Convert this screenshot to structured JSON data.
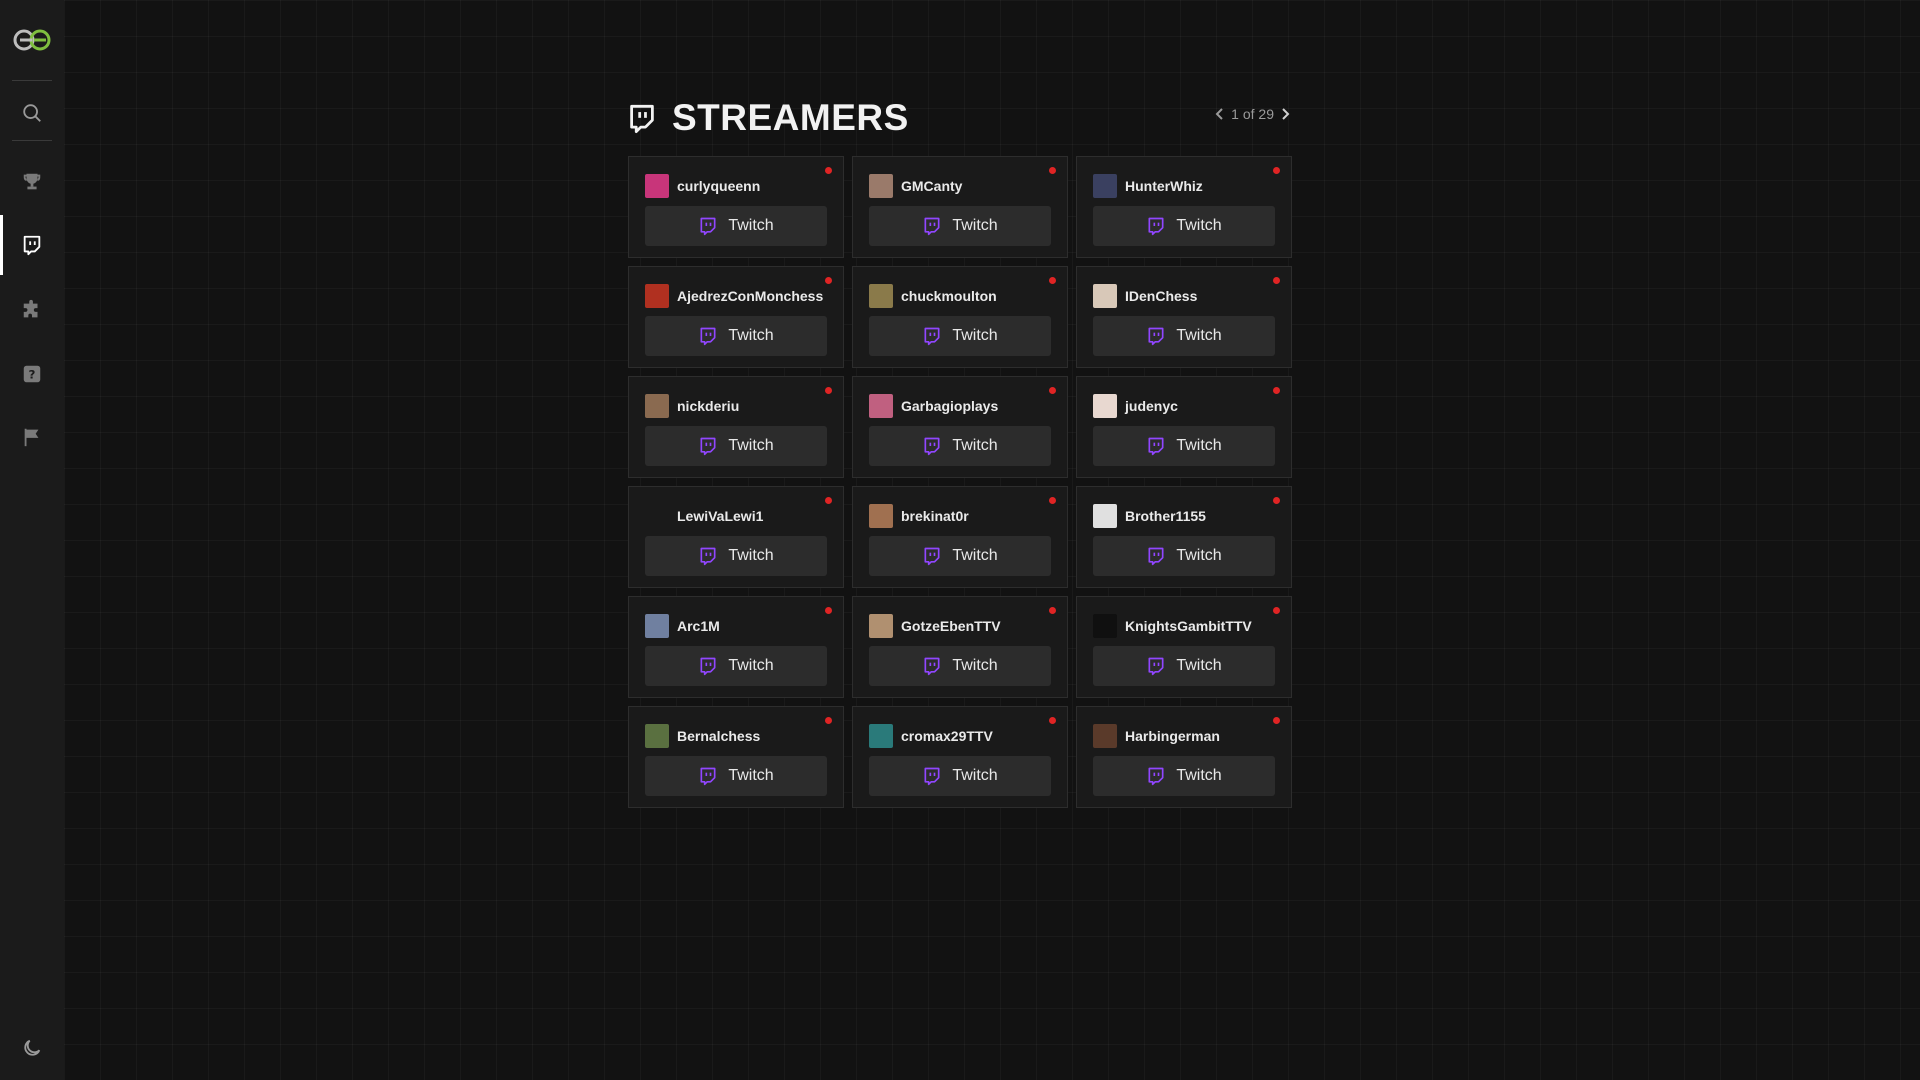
{
  "header": {
    "title": "STREAMERS",
    "pagination": "1 of 29"
  },
  "colors": {
    "background": "#121212",
    "card": "#1a1a1a",
    "button": "#2c2c2c",
    "twitch_purple": "#9146ff",
    "live": "#e02424",
    "logo_green": "#7fbf3f"
  },
  "sidebar": {
    "items": [
      {
        "icon": "search-icon"
      },
      {
        "icon": "trophy-icon"
      },
      {
        "icon": "twitch-icon",
        "active": true
      },
      {
        "icon": "puzzle-icon"
      },
      {
        "icon": "question-icon"
      },
      {
        "icon": "flag-icon"
      }
    ],
    "bottom_icon": "moon-icon"
  },
  "button_label": "Twitch",
  "streamers": [
    {
      "name": "curlyqueenn",
      "avatar": "#c8357a",
      "live": true
    },
    {
      "name": "GMCanty",
      "avatar": "#9a7a6a",
      "live": true
    },
    {
      "name": "HunterWhiz",
      "avatar": "#3a4060",
      "live": true
    },
    {
      "name": "AjedrezConMonchess",
      "avatar": "#b03020",
      "live": true
    },
    {
      "name": "chuckmoulton",
      "avatar": "#8a7a4a",
      "live": true
    },
    {
      "name": "IDenChess",
      "avatar": "#d8c8b8",
      "live": true
    },
    {
      "name": "nickderiu",
      "avatar": "#8a6a50",
      "live": true
    },
    {
      "name": "Garbagioplays",
      "avatar": "#c06080",
      "live": true
    },
    {
      "name": "judenyc",
      "avatar": "#e8d8d0",
      "live": true
    },
    {
      "name": "LewiVaLewi1",
      "avatar": "#1a1a1a",
      "live": true
    },
    {
      "name": "brekinat0r",
      "avatar": "#a07050",
      "live": true
    },
    {
      "name": "Brother1155",
      "avatar": "#e0e0e0",
      "live": true
    },
    {
      "name": "Arc1M",
      "avatar": "#7080a0",
      "live": true
    },
    {
      "name": "GotzeEbenTTV",
      "avatar": "#b09070",
      "live": true
    },
    {
      "name": "KnightsGambitTTV",
      "avatar": "#101010",
      "live": true
    },
    {
      "name": "Bernalchess",
      "avatar": "#5a7040",
      "live": true
    },
    {
      "name": "cromax29TTV",
      "avatar": "#2a7a7a",
      "live": true
    },
    {
      "name": "Harbingerman",
      "avatar": "#5a3a2a",
      "live": true
    }
  ]
}
